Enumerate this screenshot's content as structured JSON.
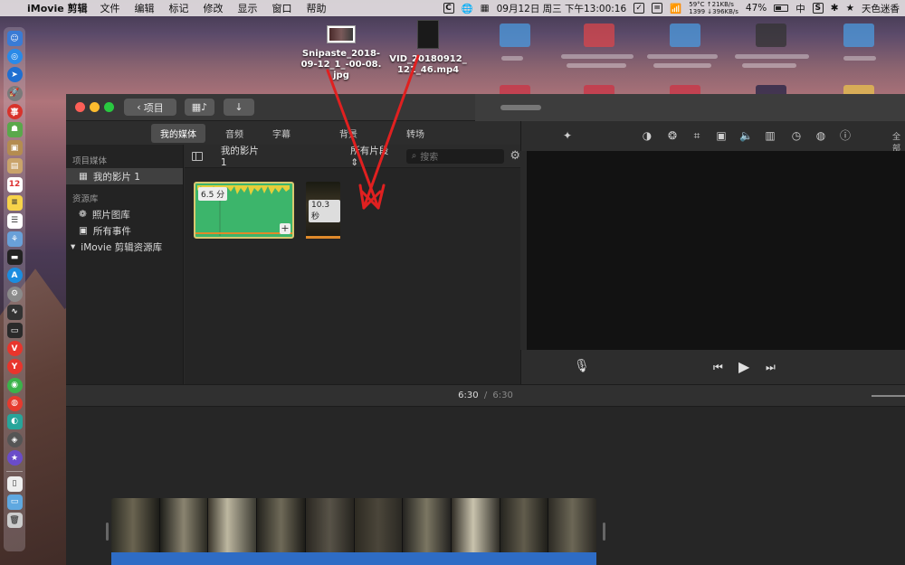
{
  "menubar": {
    "app_name": "iMovie 剪辑",
    "menus": [
      "文件",
      "编辑",
      "标记",
      "修改",
      "显示",
      "窗口",
      "帮助"
    ],
    "temp": "59°C",
    "temp_bottom": "1399",
    "net_up": "↑21KB/s",
    "net_down": "↓396KB/s",
    "datetime": "09月12日 周三 下午13:00:16",
    "battery": "47%",
    "ime": "中",
    "user": "天色迷香"
  },
  "desktop": {
    "files": [
      {
        "name": "Snipaste_2018-09-12_1_-00-08.jpg"
      },
      {
        "name": "VID_20180912_121_46.mp4"
      }
    ]
  },
  "window": {
    "back_button": "项目",
    "tabs": [
      "我的媒体",
      "音频",
      "字幕",
      "背景",
      "转场"
    ],
    "active_tab": 0,
    "sidebar": {
      "section_media": "项目媒体",
      "project": "我的影片 1",
      "section_library": "资源库",
      "photos": "照片图库",
      "all_events": "所有事件",
      "library": "iMovie 剪辑资源库"
    },
    "browser": {
      "title": "我的影片 1",
      "filter": "所有片段",
      "search_placeholder": "搜索",
      "clips": [
        {
          "duration": "6.5 分"
        },
        {
          "duration": "10.3 秒"
        }
      ]
    },
    "timecode_current": "6:30",
    "timecode_separator": "/",
    "timecode_total": "6:30",
    "viewer_partial_label": "全部"
  },
  "colors": {
    "accent_green": "#3cb56b",
    "audio_blue": "#2e6cc5",
    "arrow_red": "#e02020"
  }
}
